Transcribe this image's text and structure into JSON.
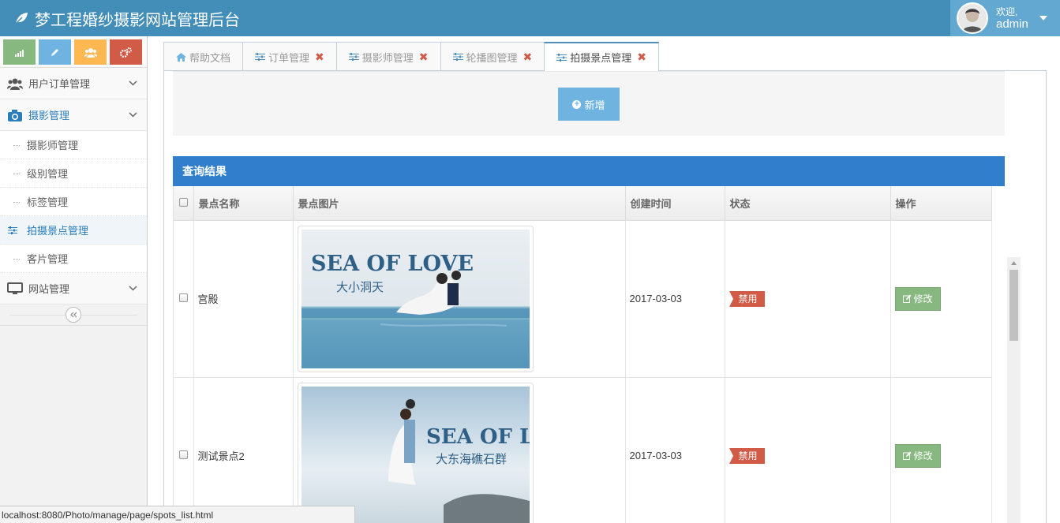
{
  "app": {
    "title": "梦工程婚纱摄影网站管理后台"
  },
  "user": {
    "welcome": "欢迎,",
    "name": "admin"
  },
  "sidebar": {
    "menus": [
      {
        "label": "用户订单管理",
        "icon": "users-icon"
      },
      {
        "label": "摄影管理",
        "icon": "camera-icon",
        "items": [
          {
            "label": "摄影师管理"
          },
          {
            "label": "级别管理"
          },
          {
            "label": "标签管理"
          },
          {
            "label": "拍摄景点管理"
          },
          {
            "label": "客片管理"
          }
        ]
      },
      {
        "label": "网站管理",
        "icon": "monitor-icon"
      }
    ]
  },
  "tabs": [
    {
      "label": "帮助文档",
      "icon": "home-icon"
    },
    {
      "label": "订单管理",
      "icon": "sliders-icon"
    },
    {
      "label": "摄影师管理",
      "icon": "sliders-icon"
    },
    {
      "label": "轮播图管理",
      "icon": "sliders-icon"
    },
    {
      "label": "拍摄景点管理",
      "icon": "sliders-icon"
    }
  ],
  "toolbar": {
    "add_label": "新增"
  },
  "results": {
    "title": "查询结果",
    "columns": [
      "景点名称",
      "景点图片",
      "创建时间",
      "状态",
      "操作"
    ],
    "rows": [
      {
        "name": "宫殿",
        "image_text_en": "SEA OF LOVE",
        "image_text_cn": "大小洞天",
        "created": "2017-03-03",
        "status": "禁用",
        "action": "修改"
      },
      {
        "name": "测试景点2",
        "image_text_en": "SEA OF LOVE",
        "image_text_cn": "大东海礁石群",
        "created": "2017-03-03",
        "status": "禁用",
        "action": "修改"
      }
    ]
  },
  "statusbar": {
    "url": "localhost:8080/Photo/manage/page/spots_list.html"
  },
  "colors": {
    "navbar": "#438eb9",
    "primary": "#307ecc",
    "danger": "#d15b47",
    "success": "#87b87f",
    "info": "#6fb3e0",
    "warning": "#ffb752"
  }
}
